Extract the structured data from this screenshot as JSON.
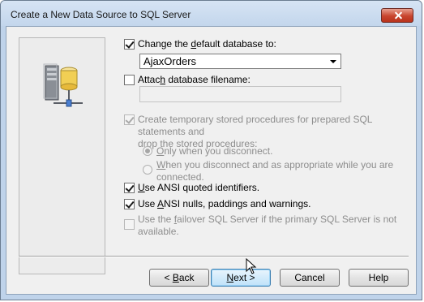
{
  "window": {
    "title": "Create a New Data Source to SQL Server"
  },
  "options": {
    "change_default_db": {
      "label_pre": "Change the ",
      "label_u": "d",
      "label_post": "efault database to:",
      "checked": true
    },
    "database_value": "AjaxOrders",
    "attach_db": {
      "label_pre": "Attac",
      "label_u": "h",
      "label_post": " database filename:",
      "checked": false
    },
    "attach_filename_value": "",
    "create_temp_sp": {
      "label_line1": "Create temporary stored procedures for prepared SQL statements and",
      "label_line2": "drop the stored procedures:",
      "checked": true,
      "enabled": false
    },
    "radio_disconnect": {
      "label_pre": "",
      "label_u": "O",
      "label_post": "nly when you disconnect.",
      "selected": true,
      "enabled": false
    },
    "radio_appropriate": {
      "label_pre": "",
      "label_u": "W",
      "label_post": "hen you disconnect and as appropriate while you are",
      "label_line2": "connected.",
      "selected": false,
      "enabled": false
    },
    "ansi_quoted": {
      "label_pre": "",
      "label_u": "U",
      "label_post": "se ANSI quoted identifiers.",
      "checked": true
    },
    "ansi_nulls": {
      "label_pre": "Use ",
      "label_u": "A",
      "label_post": "NSI nulls, paddings and warnings.",
      "checked": true
    },
    "failover": {
      "label_pre": "Use the ",
      "label_u": "f",
      "label_post": "ailover SQL Server if the primary SQL Server is not",
      "label_line2": "available.",
      "checked": false,
      "enabled": false
    }
  },
  "buttons": {
    "back": {
      "pre": "< ",
      "u": "B",
      "post": "ack"
    },
    "next": {
      "pre": "",
      "u": "N",
      "post": "ext >"
    },
    "cancel": "Cancel",
    "help": "Help"
  },
  "icons": {
    "wizard_art": "database-server-icon",
    "close": "close-icon",
    "cursor": "mouse-cursor-icon"
  },
  "colors": {
    "close_button": "#c8452e",
    "titlebar": "#c3d6ec",
    "default_button_border": "#3c7fb1"
  }
}
